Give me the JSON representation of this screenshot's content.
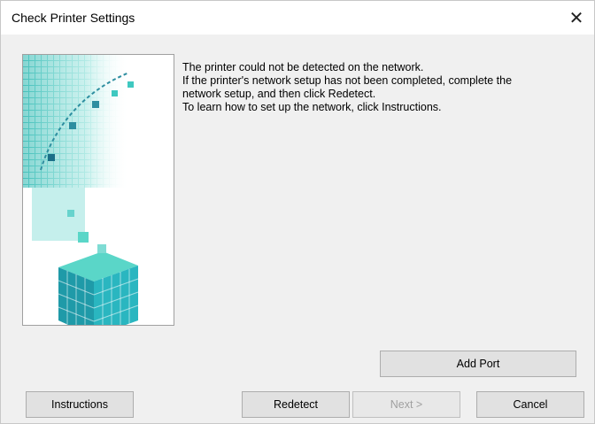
{
  "window": {
    "title": "Check Printer Settings",
    "close_glyph": "✕"
  },
  "message": {
    "lines": [
      "The printer could not be detected on the network.",
      "If the printer's network setup has not been completed, complete the",
      "network setup, and then click Redetect.",
      "To learn how to set up the network, click Instructions."
    ]
  },
  "buttons": {
    "add_port": "Add Port",
    "instructions": "Instructions",
    "redetect": "Redetect",
    "next": "Next >",
    "cancel": "Cancel"
  },
  "colors": {
    "art_teal": "#3fc8c0",
    "art_dark": "#1b6f88",
    "art_light": "#bff0ea"
  }
}
